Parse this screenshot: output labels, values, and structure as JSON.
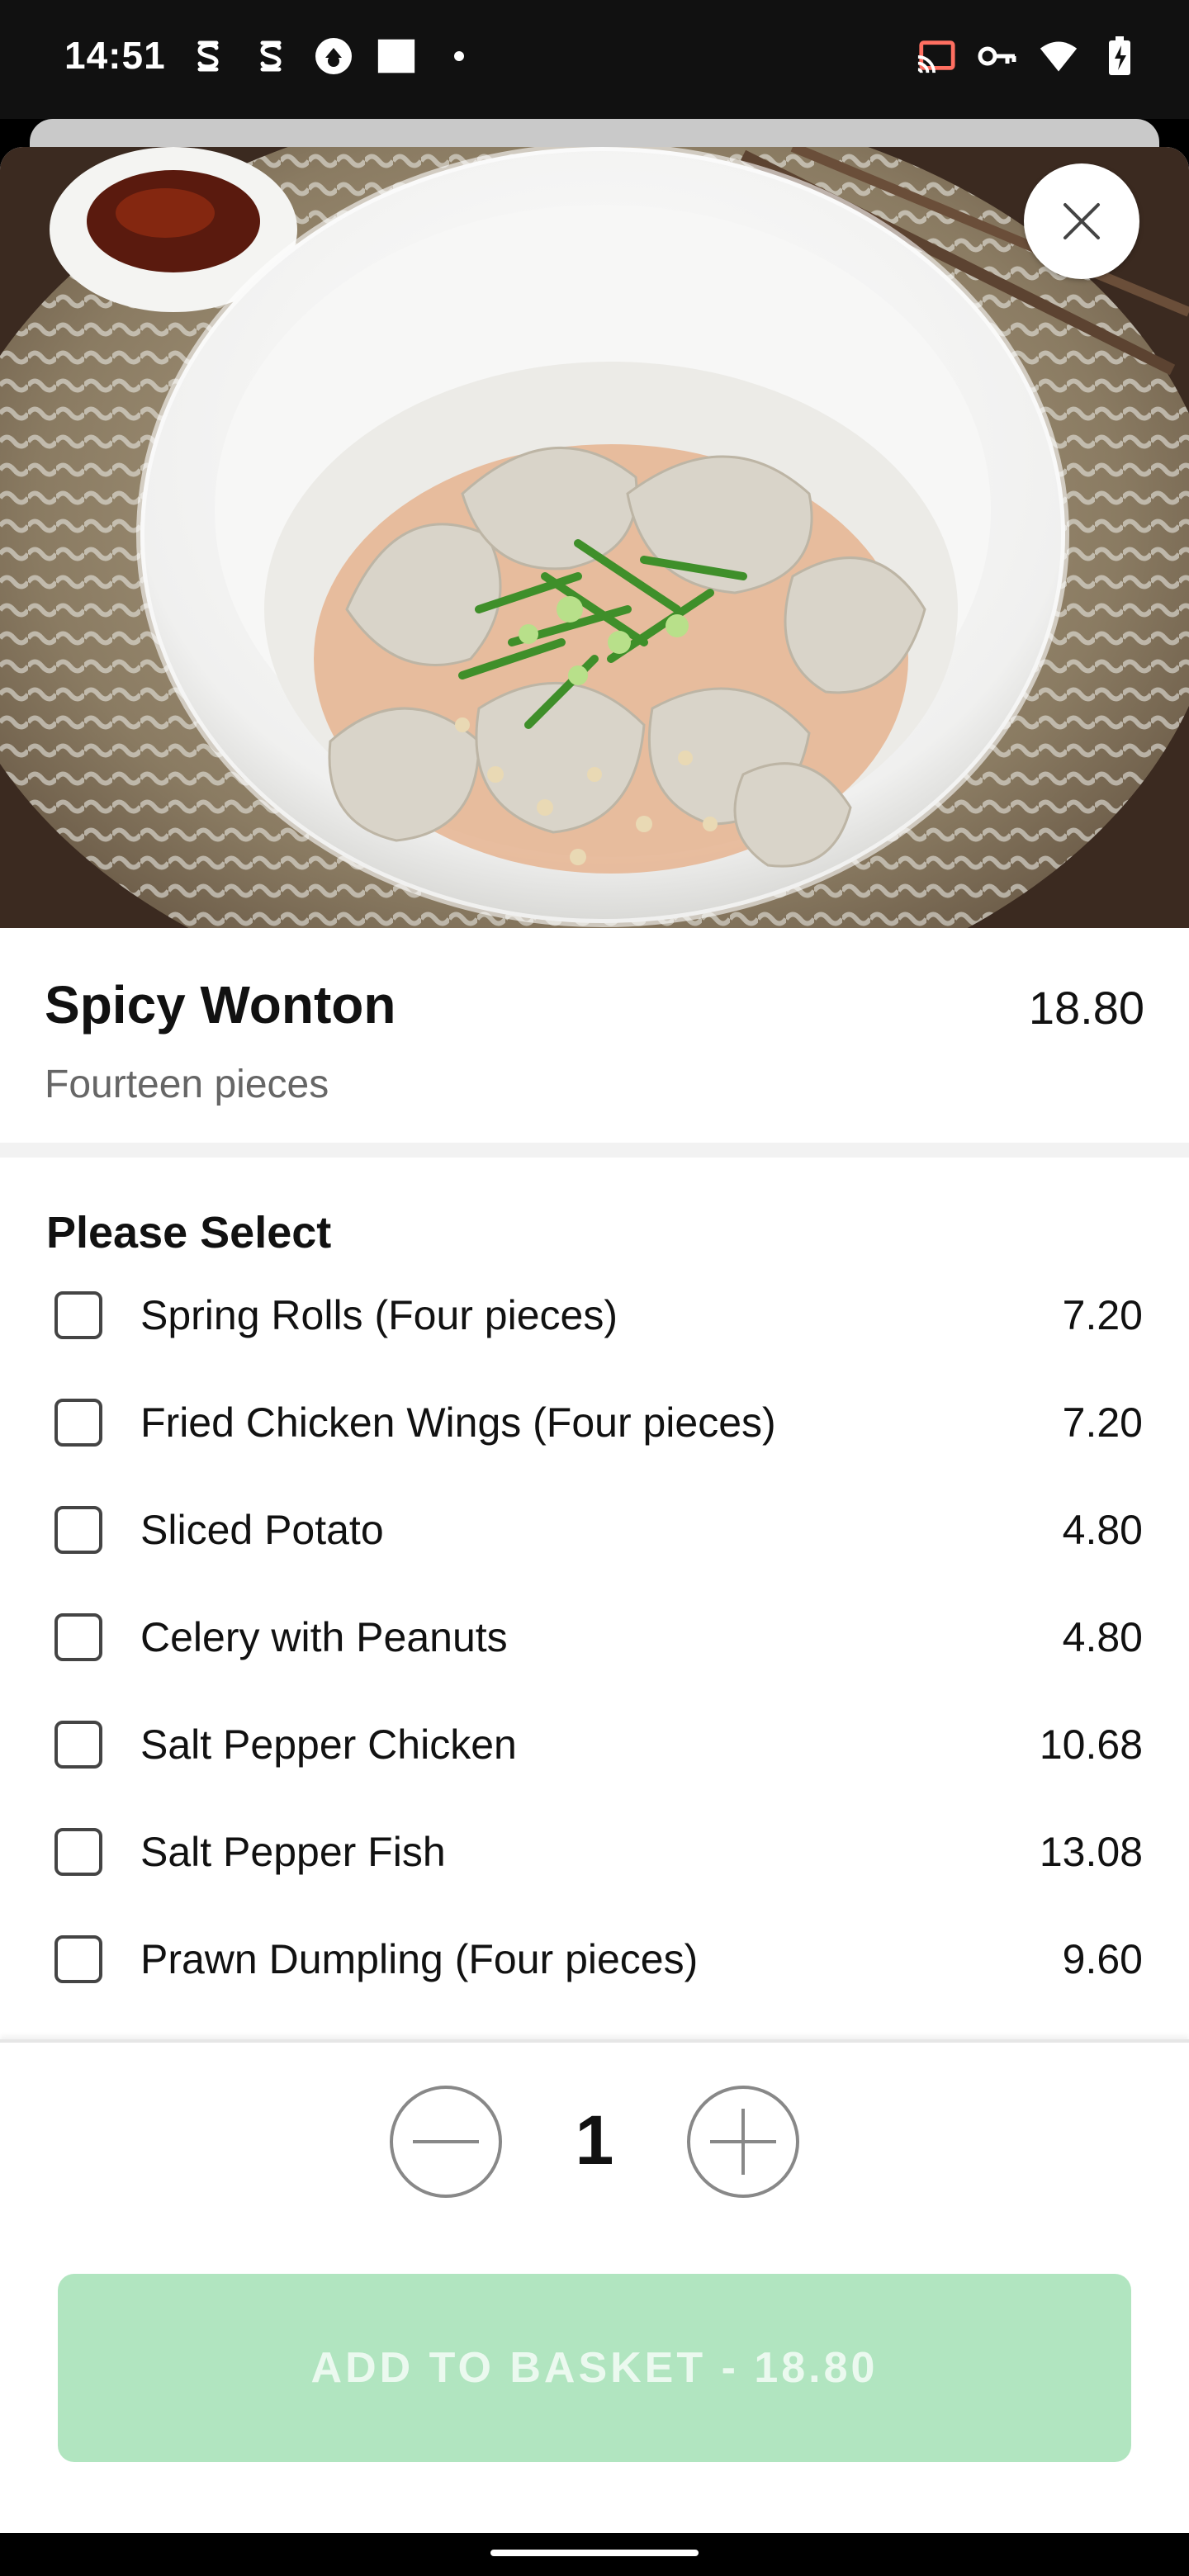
{
  "status_bar": {
    "time": "14:51",
    "left_icons": [
      "s-app-icon",
      "s-app-icon",
      "drive-sync-icon",
      "square-icon",
      "dot-icon"
    ],
    "right_icons": [
      "cast-icon",
      "vpn-key-icon",
      "wifi-icon",
      "battery-charging-icon"
    ]
  },
  "item": {
    "name": "Spicy Wonton",
    "price": "18.80",
    "description": "Fourteen pieces"
  },
  "options": {
    "title": "Please Select",
    "items": [
      {
        "label": "Spring Rolls (Four pieces)",
        "price": "7.20",
        "checked": false
      },
      {
        "label": "Fried Chicken Wings (Four pieces)",
        "price": "7.20",
        "checked": false
      },
      {
        "label": "Sliced Potato",
        "price": "4.80",
        "checked": false
      },
      {
        "label": "Celery with Peanuts",
        "price": "4.80",
        "checked": false
      },
      {
        "label": "Salt Pepper Chicken",
        "price": "10.68",
        "checked": false
      },
      {
        "label": "Salt Pepper Fish",
        "price": "13.08",
        "checked": false
      },
      {
        "label": "Prawn Dumpling (Four pieces)",
        "price": "9.60",
        "checked": false
      }
    ]
  },
  "quantity": {
    "value": "1"
  },
  "add_button": {
    "label": "ADD TO BASKET  -  18.80"
  },
  "colors": {
    "accent_disabled": "#b1e5c0"
  }
}
